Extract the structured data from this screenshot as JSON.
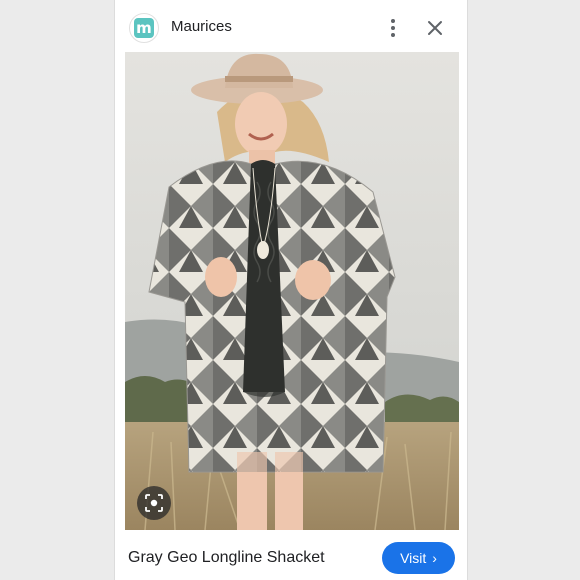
{
  "header": {
    "brand_logo_letter": "m",
    "brand_name": "Maurices",
    "more_icon": "more-vert-icon",
    "close_icon": "close-icon"
  },
  "photo": {
    "lens_icon": "lens-search-icon"
  },
  "footer": {
    "product_title": "Gray Geo Longline Shacket",
    "visit_label": "Visit",
    "visit_chevron": "›"
  },
  "colors": {
    "page_background": "#ececec",
    "card_background": "#ffffff",
    "brand_teal": "#5bc4c0",
    "visit_blue": "#1a73e8",
    "text": "#202124"
  }
}
